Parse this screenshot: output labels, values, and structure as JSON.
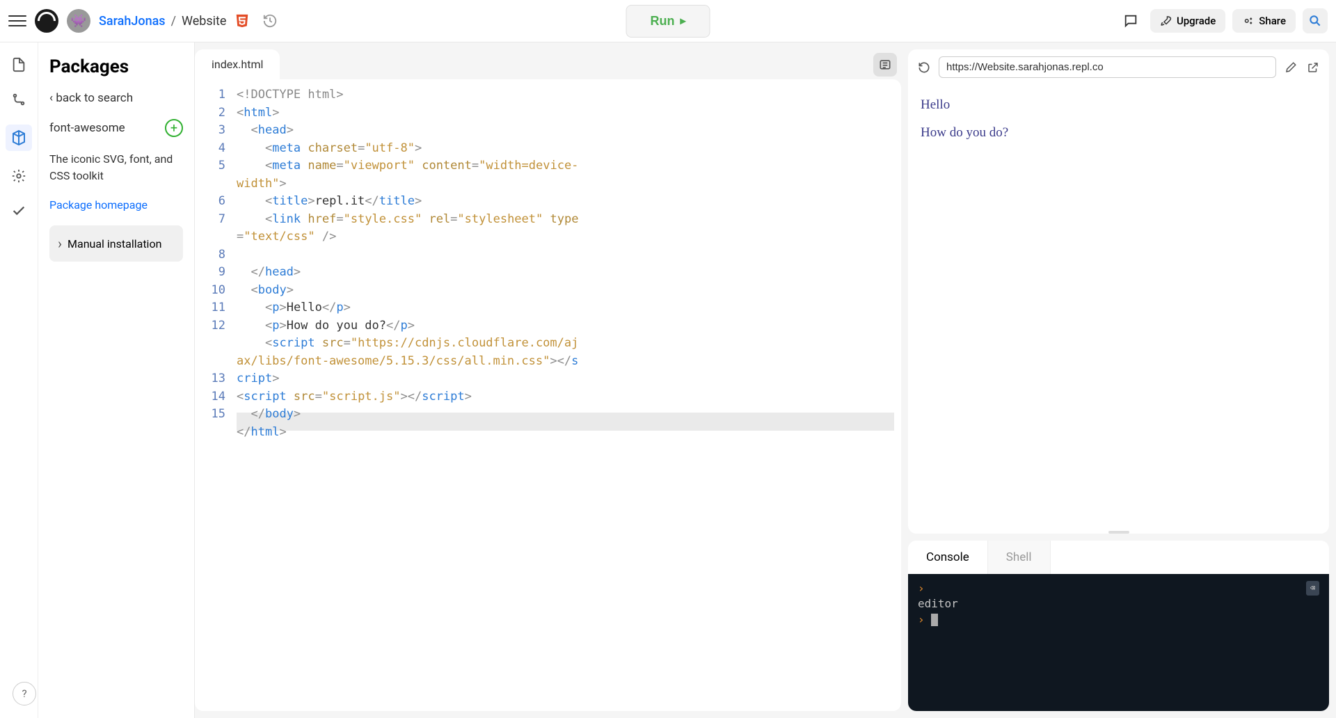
{
  "header": {
    "user": "SarahJonas",
    "project": "Website",
    "run_label": "Run",
    "upgrade": "Upgrade",
    "share": "Share"
  },
  "sidebar": {
    "title": "Packages",
    "back": "‹ back to search",
    "package_name": "font-awesome",
    "package_desc": "The iconic SVG, font, and CSS toolkit",
    "homepage_link": "Package homepage",
    "manual": "Manual installation"
  },
  "editor": {
    "filename": "index.html",
    "active_line": 8,
    "lines": [
      {
        "n": 1,
        "tokens": [
          {
            "t": "<!DOCTYPE html>",
            "c": "t-doctype"
          }
        ]
      },
      {
        "n": 2,
        "tokens": [
          {
            "t": "<",
            "c": "t-punc"
          },
          {
            "t": "html",
            "c": "t-tag"
          },
          {
            "t": ">",
            "c": "t-punc"
          }
        ]
      },
      {
        "n": 3,
        "indent": 2,
        "tokens": [
          {
            "t": "<",
            "c": "t-punc"
          },
          {
            "t": "head",
            "c": "t-tag"
          },
          {
            "t": ">",
            "c": "t-punc"
          }
        ]
      },
      {
        "n": 4,
        "indent": 4,
        "tokens": [
          {
            "t": "<",
            "c": "t-punc"
          },
          {
            "t": "meta",
            "c": "t-tag"
          },
          {
            "t": " "
          },
          {
            "t": "charset",
            "c": "t-attr"
          },
          {
            "t": "=",
            "c": "t-punc"
          },
          {
            "t": "\"utf-8\"",
            "c": "t-str"
          },
          {
            "t": ">",
            "c": "t-punc"
          }
        ]
      },
      {
        "n": 5,
        "indent": 4,
        "wrap": true,
        "tokens": [
          {
            "t": "<",
            "c": "t-punc"
          },
          {
            "t": "meta",
            "c": "t-tag"
          },
          {
            "t": " "
          },
          {
            "t": "name",
            "c": "t-attr"
          },
          {
            "t": "=",
            "c": "t-punc"
          },
          {
            "t": "\"viewport\"",
            "c": "t-str"
          },
          {
            "t": " "
          },
          {
            "t": "content",
            "c": "t-attr"
          },
          {
            "t": "=",
            "c": "t-punc"
          },
          {
            "t": "\"width=device-width\"",
            "c": "t-str"
          },
          {
            "t": ">",
            "c": "t-punc"
          }
        ]
      },
      {
        "n": 6,
        "indent": 4,
        "tokens": [
          {
            "t": "<",
            "c": "t-punc"
          },
          {
            "t": "title",
            "c": "t-tag"
          },
          {
            "t": ">",
            "c": "t-punc"
          },
          {
            "t": "repl.it",
            "c": "t-text"
          },
          {
            "t": "</",
            "c": "t-punc"
          },
          {
            "t": "title",
            "c": "t-tag"
          },
          {
            "t": ">",
            "c": "t-punc"
          }
        ]
      },
      {
        "n": 7,
        "indent": 4,
        "wrap": true,
        "tokens": [
          {
            "t": "<",
            "c": "t-punc"
          },
          {
            "t": "link",
            "c": "t-tag"
          },
          {
            "t": " "
          },
          {
            "t": "href",
            "c": "t-attr"
          },
          {
            "t": "=",
            "c": "t-punc"
          },
          {
            "t": "\"style.css\"",
            "c": "t-str"
          },
          {
            "t": " "
          },
          {
            "t": "rel",
            "c": "t-attr"
          },
          {
            "t": "=",
            "c": "t-punc"
          },
          {
            "t": "\"stylesheet\"",
            "c": "t-str"
          },
          {
            "t": " "
          },
          {
            "t": "type",
            "c": "t-attr"
          },
          {
            "t": "=",
            "c": "t-punc"
          },
          {
            "t": "\"text/css\"",
            "c": "t-str"
          },
          {
            "t": " />",
            "c": "t-punc"
          }
        ]
      },
      {
        "n": 8,
        "indent": 2,
        "tokens": [
          {
            "t": "</",
            "c": "t-punc"
          },
          {
            "t": "head",
            "c": "t-tag"
          },
          {
            "t": ">",
            "c": "t-punc"
          }
        ]
      },
      {
        "n": 9,
        "indent": 2,
        "tokens": [
          {
            "t": "<",
            "c": "t-punc"
          },
          {
            "t": "body",
            "c": "t-tag"
          },
          {
            "t": ">",
            "c": "t-punc"
          }
        ]
      },
      {
        "n": 10,
        "indent": 4,
        "tokens": [
          {
            "t": "<",
            "c": "t-punc"
          },
          {
            "t": "p",
            "c": "t-tag"
          },
          {
            "t": ">",
            "c": "t-punc"
          },
          {
            "t": "Hello",
            "c": "t-text"
          },
          {
            "t": "</",
            "c": "t-punc"
          },
          {
            "t": "p",
            "c": "t-tag"
          },
          {
            "t": ">",
            "c": "t-punc"
          }
        ]
      },
      {
        "n": 11,
        "indent": 4,
        "tokens": [
          {
            "t": "<",
            "c": "t-punc"
          },
          {
            "t": "p",
            "c": "t-tag"
          },
          {
            "t": ">",
            "c": "t-punc"
          },
          {
            "t": "How do you do?",
            "c": "t-text"
          },
          {
            "t": "</",
            "c": "t-punc"
          },
          {
            "t": "p",
            "c": "t-tag"
          },
          {
            "t": ">",
            "c": "t-punc"
          }
        ]
      },
      {
        "n": 12,
        "indent": 4,
        "wrap": true,
        "height": 3,
        "tokens": [
          {
            "t": "<",
            "c": "t-punc"
          },
          {
            "t": "script",
            "c": "t-tag"
          },
          {
            "t": " "
          },
          {
            "t": "src",
            "c": "t-attr"
          },
          {
            "t": "=",
            "c": "t-punc"
          },
          {
            "t": "\"https://cdnjs.cloudflare.com/ajax/libs/font-awesome/5.15.3/css/all.min.css\"",
            "c": "t-str"
          },
          {
            "t": "></",
            "c": "t-punc"
          },
          {
            "t": "script",
            "c": "t-tag"
          },
          {
            "t": ">",
            "c": "t-punc"
          }
        ]
      },
      {
        "n": 13,
        "tokens": [
          {
            "t": "<",
            "c": "t-punc"
          },
          {
            "t": "script",
            "c": "t-tag"
          },
          {
            "t": " "
          },
          {
            "t": "src",
            "c": "t-attr"
          },
          {
            "t": "=",
            "c": "t-punc"
          },
          {
            "t": "\"script.js\"",
            "c": "t-str"
          },
          {
            "t": "></",
            "c": "t-punc"
          },
          {
            "t": "script",
            "c": "t-tag"
          },
          {
            "t": ">",
            "c": "t-punc"
          }
        ]
      },
      {
        "n": 14,
        "indent": 2,
        "tokens": [
          {
            "t": "</",
            "c": "t-punc"
          },
          {
            "t": "body",
            "c": "t-tag"
          },
          {
            "t": ">",
            "c": "t-punc"
          }
        ]
      },
      {
        "n": 15,
        "tokens": [
          {
            "t": "</",
            "c": "t-punc"
          },
          {
            "t": "html",
            "c": "t-tag"
          },
          {
            "t": ">",
            "c": "t-punc"
          }
        ]
      }
    ]
  },
  "preview": {
    "url": "https://Website.sarahjonas.repl.co",
    "lines": [
      "Hello",
      "How do you do?"
    ]
  },
  "console": {
    "tabs": [
      "Console",
      "Shell"
    ],
    "active_tab": 0,
    "output": "editor"
  }
}
